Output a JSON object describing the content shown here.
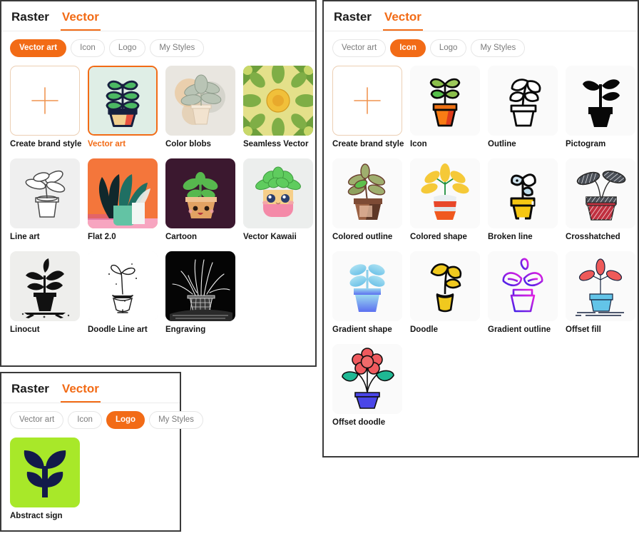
{
  "panels": [
    {
      "id": "vector-art",
      "tabs": [
        {
          "label": "Raster",
          "active": false
        },
        {
          "label": "Vector",
          "active": true
        }
      ],
      "filters": [
        {
          "label": "Vector art",
          "active": true
        },
        {
          "label": "Icon",
          "active": false
        },
        {
          "label": "Logo",
          "active": false
        },
        {
          "label": "My Styles",
          "active": false
        }
      ],
      "cards": [
        {
          "label": "Create brand style",
          "icon": "plus-placeholder",
          "state": "blank"
        },
        {
          "label": "Vector art",
          "icon": "plant-vector-art",
          "state": "selected"
        },
        {
          "label": "Color blobs",
          "icon": "plant-color-blobs",
          "state": "normal"
        },
        {
          "label": "Seamless Vector",
          "icon": "sunflower-seamless",
          "state": "normal"
        },
        {
          "label": "Line art",
          "icon": "plant-line-art",
          "state": "normal"
        },
        {
          "label": "Flat 2.0",
          "icon": "plant-flat-2",
          "state": "normal"
        },
        {
          "label": "Cartoon",
          "icon": "plant-cartoon",
          "state": "normal"
        },
        {
          "label": "Vector Kawaii",
          "icon": "plant-kawaii",
          "state": "normal"
        },
        {
          "label": "Linocut",
          "icon": "plant-linocut",
          "state": "normal"
        },
        {
          "label": "Doodle Line art",
          "icon": "plant-doodle-line",
          "state": "normal"
        },
        {
          "label": "Engraving",
          "icon": "plant-engraving",
          "state": "normal"
        }
      ]
    },
    {
      "id": "icon",
      "tabs": [
        {
          "label": "Raster",
          "active": false
        },
        {
          "label": "Vector",
          "active": true
        }
      ],
      "filters": [
        {
          "label": "Vector art",
          "active": false
        },
        {
          "label": "Icon",
          "active": true
        },
        {
          "label": "Logo",
          "active": false
        },
        {
          "label": "My Styles",
          "active": false
        }
      ],
      "cards": [
        {
          "label": "Create brand style",
          "icon": "plus-placeholder",
          "state": "blank"
        },
        {
          "label": "Icon",
          "icon": "plant-icon-orange",
          "state": "normal"
        },
        {
          "label": "Outline",
          "icon": "plant-outline",
          "state": "normal"
        },
        {
          "label": "Pictogram",
          "icon": "plant-pictogram",
          "state": "normal"
        },
        {
          "label": "Colored outline",
          "icon": "plant-colored-outline",
          "state": "normal"
        },
        {
          "label": "Colored shape",
          "icon": "plant-colored-shape",
          "state": "normal"
        },
        {
          "label": "Broken line",
          "icon": "plant-broken-line",
          "state": "normal"
        },
        {
          "label": "Crosshatched",
          "icon": "plant-crosshatched",
          "state": "normal"
        },
        {
          "label": "Gradient shape",
          "icon": "plant-gradient-shape",
          "state": "normal"
        },
        {
          "label": "Doodle",
          "icon": "plant-doodle",
          "state": "normal"
        },
        {
          "label": "Gradient outline",
          "icon": "plant-gradient-outline",
          "state": "normal"
        },
        {
          "label": "Offset fill",
          "icon": "plant-offset-fill",
          "state": "normal"
        },
        {
          "label": "Offset doodle",
          "icon": "flower-offset-doodle",
          "state": "normal"
        }
      ]
    },
    {
      "id": "logo",
      "tabs": [
        {
          "label": "Raster",
          "active": false
        },
        {
          "label": "Vector",
          "active": true
        }
      ],
      "filters": [
        {
          "label": "Vector art",
          "active": false
        },
        {
          "label": "Icon",
          "active": false
        },
        {
          "label": "Logo",
          "active": true
        },
        {
          "label": "My Styles",
          "active": false
        }
      ],
      "cards": [
        {
          "label": "Abstract sign",
          "icon": "leaf-abstract-sign",
          "state": "normal"
        }
      ]
    }
  ],
  "colors": {
    "accent": "#f26b16",
    "tab_inactive": "#1b1b1b",
    "pill_text": "#7b7b7b",
    "thumb_bg": "#f4f4f4",
    "selected_bg": "#dfeee6",
    "panel_border": "#3a3a3a"
  }
}
